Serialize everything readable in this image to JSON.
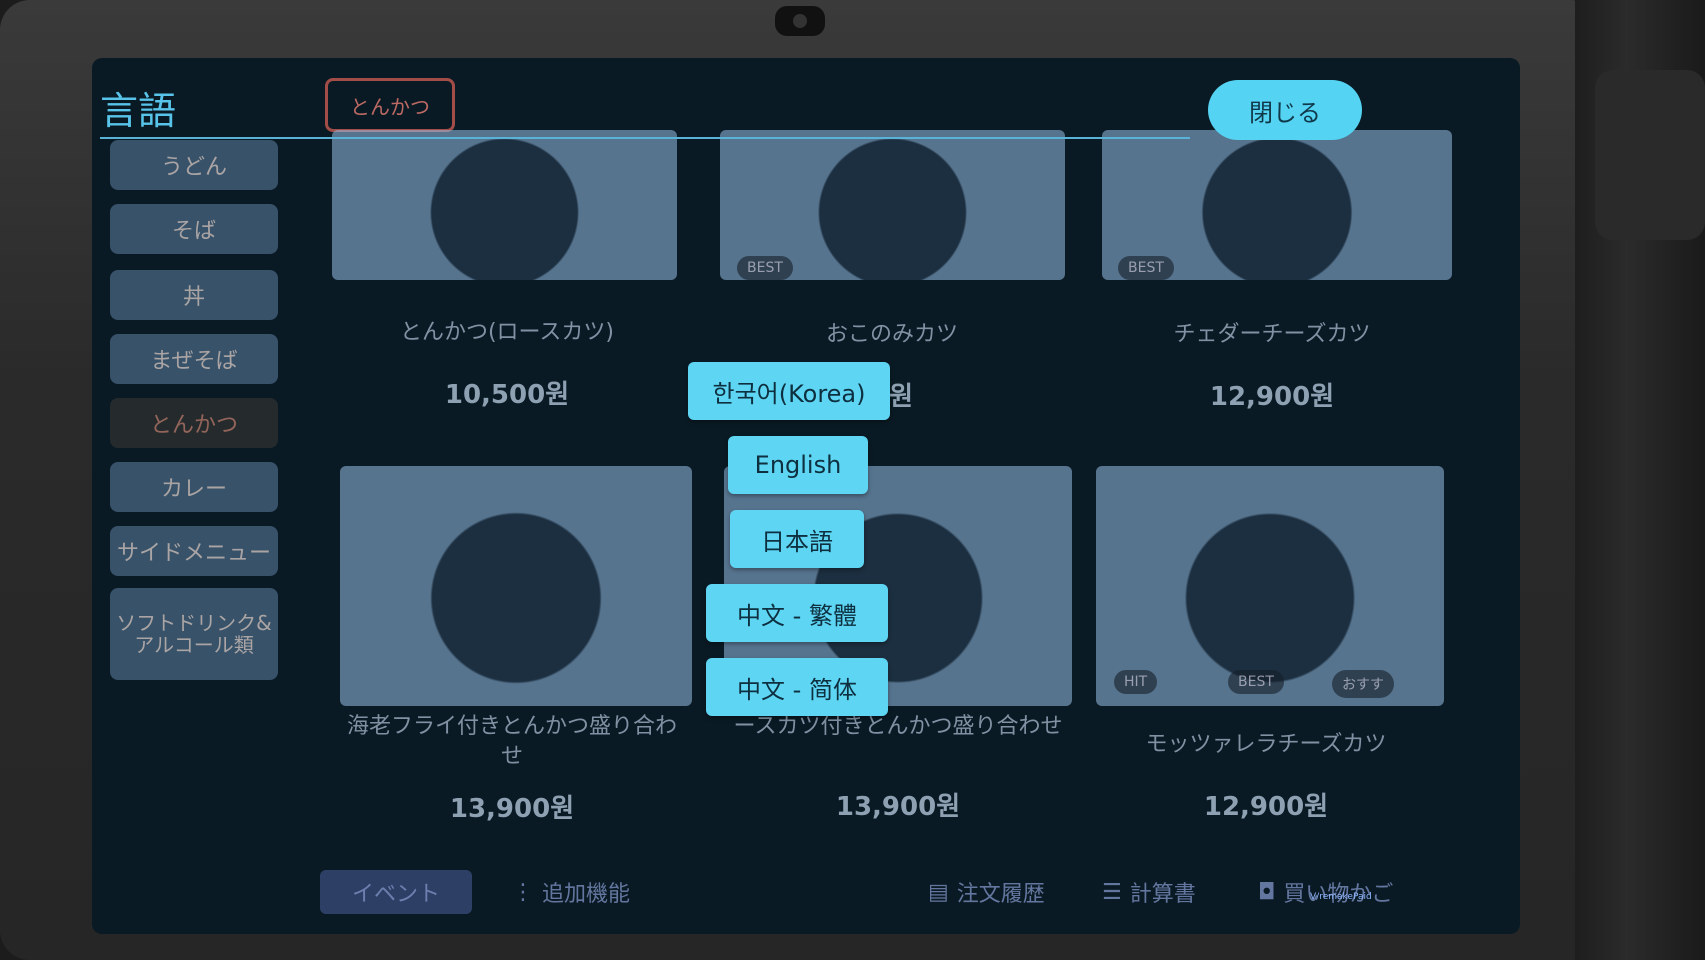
{
  "overlay": {
    "title": "言語",
    "close_label": "閉じる",
    "languages": [
      "한국어(Korea)",
      "English",
      "日本語",
      "中文 - 繁體",
      "中文 - 简体"
    ]
  },
  "background_menu": {
    "breadcrumb": "とんかつ",
    "categories": [
      "うどん",
      "そば",
      "丼",
      "まぜそば",
      "とんかつ",
      "カレー",
      "サイドメニュー",
      "ソフトドリンク&アルコール類"
    ],
    "active_category": "とんかつ",
    "items": [
      {
        "name": "とんかつ(ロースカツ)",
        "price": "10,500원",
        "badges": []
      },
      {
        "name": "おこのみカツ",
        "price": "0원",
        "badges": [
          "BEST"
        ]
      },
      {
        "name": "チェダーチーズカツ",
        "price": "12,900원",
        "badges": [
          "BEST"
        ]
      },
      {
        "name": "海老フライ付きとんかつ盛り合わせ",
        "price": "13,900원",
        "badges": []
      },
      {
        "name": "ースカツ付きとんかつ盛り合わせ",
        "price": "13,900원",
        "badges": []
      },
      {
        "name": "モッツァレラチーズカツ",
        "price": "12,900원",
        "badges": [
          "HIT",
          "BEST",
          "おすす"
        ]
      }
    ],
    "bottom_bar": {
      "event": "イベント",
      "extra": "追加機能",
      "history": "注文履歴",
      "bill": "計算書",
      "cart": "買い物かご"
    },
    "brand": "V/remakePaid"
  }
}
